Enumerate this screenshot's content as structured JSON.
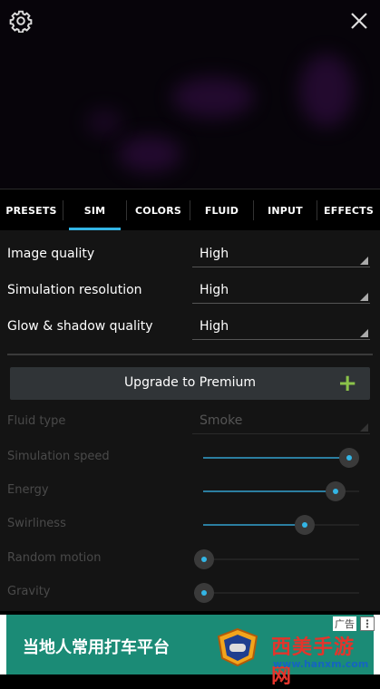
{
  "tabs": [
    {
      "label": "PRESETS",
      "active": false
    },
    {
      "label": "SIM",
      "active": true
    },
    {
      "label": "COLORS",
      "active": false
    },
    {
      "label": "FLUID",
      "active": false
    },
    {
      "label": "INPUT",
      "active": false
    },
    {
      "label": "EFFECTS",
      "active": false
    }
  ],
  "settings": [
    {
      "label": "Image quality",
      "value": "High"
    },
    {
      "label": "Simulation resolution",
      "value": "High"
    },
    {
      "label": "Glow & shadow quality",
      "value": "High"
    }
  ],
  "upgrade": {
    "label": "Upgrade to Premium",
    "icon": "plus-icon"
  },
  "fluid_type": {
    "label": "Fluid type",
    "value": "Smoke"
  },
  "sliders": [
    {
      "label": "Simulation speed",
      "level": 1.0
    },
    {
      "label": "Energy",
      "level": 0.9
    },
    {
      "label": "Swirliness",
      "level": 0.67
    },
    {
      "label": "Random motion",
      "level": 0.0
    },
    {
      "label": "Gravity",
      "level": 0.0
    }
  ],
  "ad": {
    "text": "当地人常用打车平台",
    "tag": "广告",
    "watermark": "西美手游网",
    "url": "www.hanxm.com"
  },
  "colors": {
    "accent": "#33b5e5",
    "plus": "#8bc34a",
    "ad_bg": "#1b8b76"
  }
}
